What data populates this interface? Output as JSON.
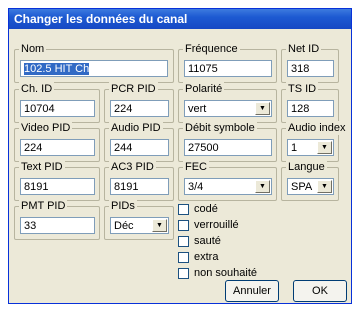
{
  "window": {
    "title": "Changer les données du canal"
  },
  "fields": {
    "nom": {
      "label": "Nom",
      "value": "102.5 HIT Ch"
    },
    "frequence": {
      "label": "Fréquence",
      "value": "11075"
    },
    "net_id": {
      "label": "Net ID",
      "value": "318"
    },
    "ch_id": {
      "label": "Ch. ID",
      "value": "10704"
    },
    "pcr_pid": {
      "label": "PCR PID",
      "value": "224"
    },
    "polarite": {
      "label": "Polarité",
      "value": "vert"
    },
    "ts_id": {
      "label": "TS ID",
      "value": "128"
    },
    "video_pid": {
      "label": "Video PID",
      "value": "224"
    },
    "audio_pid": {
      "label": "Audio PID",
      "value": "244"
    },
    "debit_symbole": {
      "label": "Débit symbole",
      "value": "27500"
    },
    "audio_index": {
      "label": "Audio index",
      "value": "1"
    },
    "text_pid": {
      "label": "Text PID",
      "value": "8191"
    },
    "ac3_pid": {
      "label": "AC3 PID",
      "value": "8191"
    },
    "fec": {
      "label": "FEC",
      "value": "3/4"
    },
    "langue": {
      "label": "Langue",
      "value": "SPA"
    },
    "pmt_pid": {
      "label": "PMT PID",
      "value": "33"
    },
    "pids": {
      "label": "PIDs",
      "value": "Déc"
    }
  },
  "checkboxes": [
    {
      "label": "codé",
      "checked": false
    },
    {
      "label": "verrouillé",
      "checked": false
    },
    {
      "label": "sauté",
      "checked": false
    },
    {
      "label": "extra",
      "checked": false
    },
    {
      "label": "non souhaité",
      "checked": false
    }
  ],
  "buttons": {
    "cancel": "Annuler",
    "ok": "OK"
  }
}
